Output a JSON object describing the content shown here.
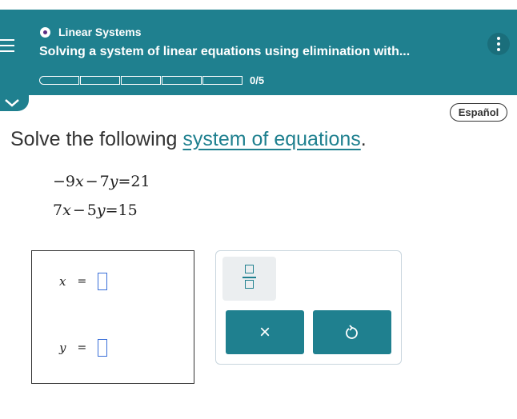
{
  "header": {
    "topic": "Linear Systems",
    "lesson_title": "Solving a system of linear equations using elimination with...",
    "progress_text": "0/5",
    "progress_segments": 5,
    "progress_completed": 0,
    "color": "#1f808f"
  },
  "language_button": "Español",
  "prompt": {
    "before": "Solve the following ",
    "link": "system of equations",
    "after": "."
  },
  "equations": [
    {
      "lhs_a": "−9",
      "var_a": "x",
      "op": "−",
      "lhs_b": "7",
      "var_b": "y",
      "rhs": "=21"
    },
    {
      "lhs_a": "7",
      "var_a": "x",
      "op": "−",
      "lhs_b": "5",
      "var_b": "y",
      "rhs": "=15"
    }
  ],
  "answers": [
    {
      "var": "x",
      "equals": "=",
      "value": ""
    },
    {
      "var": "y",
      "equals": "=",
      "value": ""
    }
  ],
  "tools": {
    "fraction_icon": "fraction-icon",
    "clear_label": "×",
    "undo_icon": "undo-icon"
  }
}
